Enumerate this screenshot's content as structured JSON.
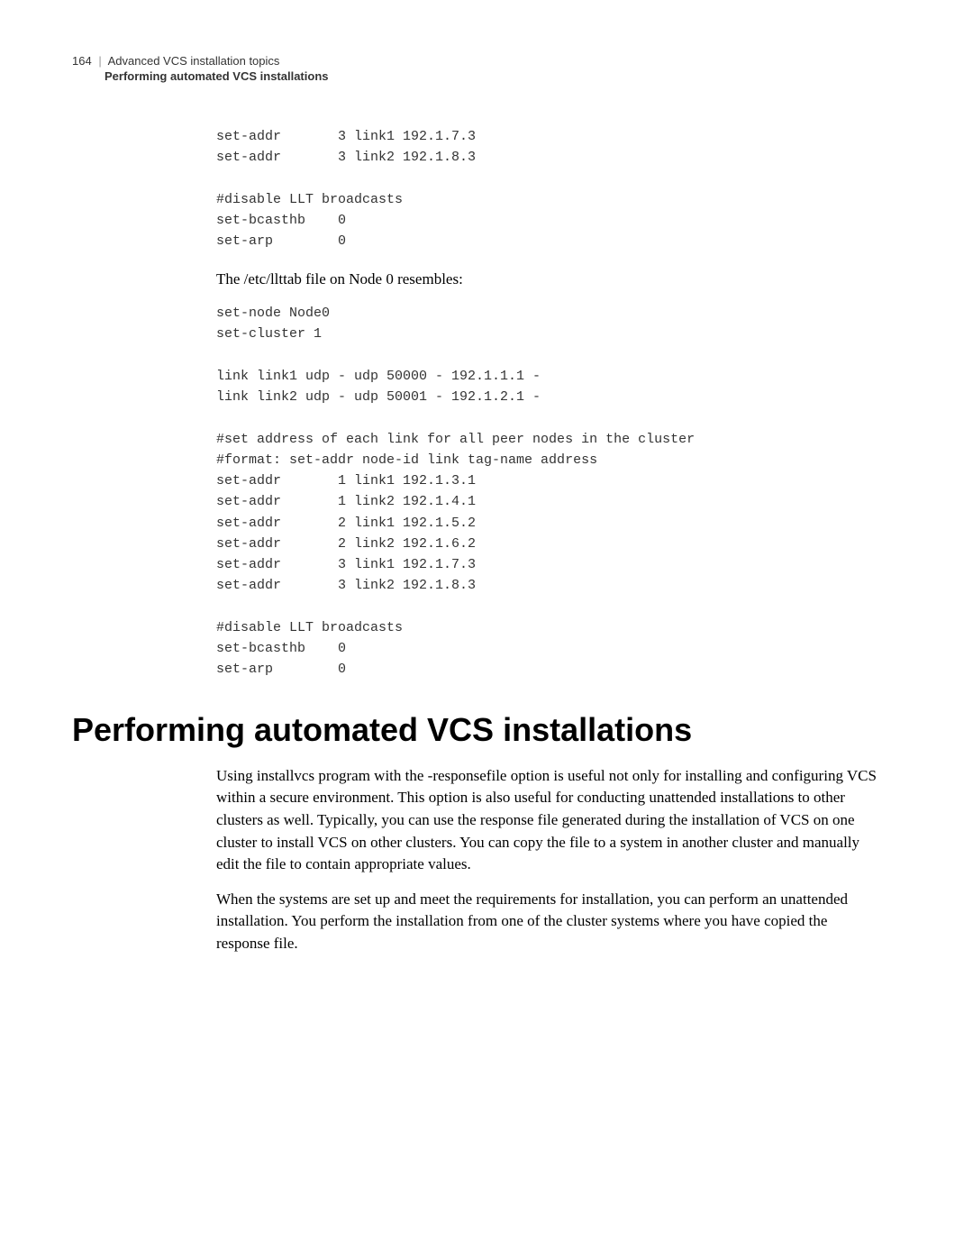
{
  "header": {
    "page_number": "164",
    "title": "Advanced VCS installation topics",
    "subtitle": "Performing automated VCS installations"
  },
  "code_block_1": "set-addr       3 link1 192.1.7.3\nset-addr       3 link2 192.1.8.3\n\n#disable LLT broadcasts\nset-bcasthb    0\nset-arp        0",
  "para_1": "The /etc/llttab file on Node 0 resembles:",
  "code_block_2": "set-node Node0\nset-cluster 1\n\nlink link1 udp - udp 50000 - 192.1.1.1 -\nlink link2 udp - udp 50001 - 192.1.2.1 -\n\n#set address of each link for all peer nodes in the cluster\n#format: set-addr node-id link tag-name address\nset-addr       1 link1 192.1.3.1\nset-addr       1 link2 192.1.4.1\nset-addr       2 link1 192.1.5.2\nset-addr       2 link2 192.1.6.2\nset-addr       3 link1 192.1.7.3\nset-addr       3 link2 192.1.8.3\n\n#disable LLT broadcasts\nset-bcasthb    0\nset-arp        0",
  "heading_1": "Performing automated VCS installations",
  "para_2": "Using installvcs program with the -responsefile option is useful not only for installing and configuring VCS within a secure environment. This option is also useful for conducting unattended installations to other clusters as well. Typically, you can use the response file generated during the installation of VCS on one cluster to install VCS on other clusters. You can copy the file to a system in another cluster and manually edit the file to contain appropriate values.",
  "para_3": "When the systems are set up and meet the requirements for installation, you can perform an unattended installation. You perform the installation from one of the cluster systems where you have copied the response file."
}
